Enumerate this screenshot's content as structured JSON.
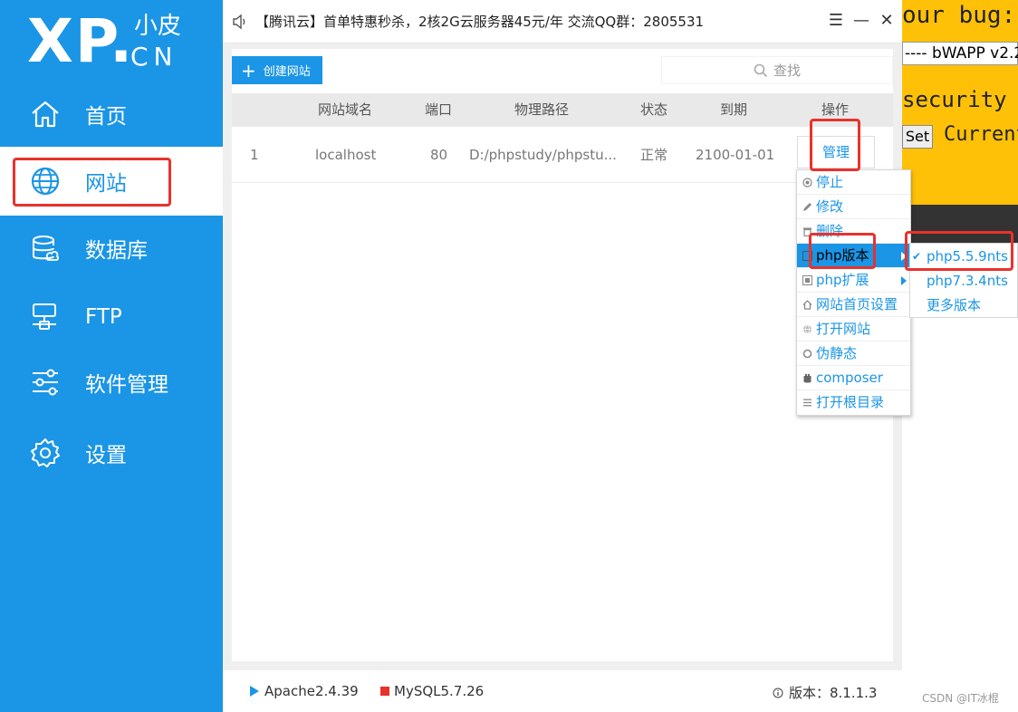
{
  "logo": {
    "main": "XP.",
    "small": "小皮",
    "domain": "CN"
  },
  "sidebar": {
    "items": [
      {
        "label": "首页",
        "icon": "home-icon"
      },
      {
        "label": "网站",
        "icon": "globe-icon",
        "active": true
      },
      {
        "label": "数据库",
        "icon": "database-icon"
      },
      {
        "label": "FTP",
        "icon": "ftp-server-icon"
      },
      {
        "label": "软件管理",
        "icon": "sliders-icon"
      },
      {
        "label": "设置",
        "icon": "gear-icon"
      }
    ]
  },
  "topbar": {
    "notice": "【腾讯云】首单特惠秒杀，2核2G云服务器45元/年 交流QQ群：2805531",
    "menu_glyph": "☰",
    "minimize_glyph": "—",
    "close_glyph": "✕"
  },
  "toolbar": {
    "create_label": "创建网站",
    "search_placeholder": "查找"
  },
  "table": {
    "headers": [
      "网站域名",
      "端口",
      "物理路径",
      "状态",
      "到期",
      "操作"
    ],
    "rows": [
      {
        "index": "1",
        "domain": "localhost",
        "port": "80",
        "path": "D:/phpstudy/phpstu...",
        "status": "正常",
        "expiry": "2100-01-01",
        "action": "管理"
      }
    ]
  },
  "context_menu": {
    "items": [
      {
        "label": "停止",
        "icon": "stop-icon"
      },
      {
        "label": "修改",
        "icon": "edit-icon"
      },
      {
        "label": "删除",
        "icon": "trash-icon"
      },
      {
        "label": "php版本",
        "icon": "php-icon",
        "submenu": true,
        "highlighted": true
      },
      {
        "label": "php扩展",
        "icon": "extension-icon",
        "submenu": true
      },
      {
        "label": "网站首页设置",
        "icon": "home-icon"
      },
      {
        "label": "打开网站",
        "icon": "globe-icon"
      },
      {
        "label": "伪静态",
        "icon": "refresh-icon"
      },
      {
        "label": "composer",
        "icon": "composer-icon"
      },
      {
        "label": "打开根目录",
        "icon": "list-icon"
      }
    ]
  },
  "php_versions": {
    "items": [
      {
        "label": "php5.5.9nts",
        "checked": true
      },
      {
        "label": "php7.3.4nts",
        "checked": false
      },
      {
        "label": "更多版本",
        "checked": false
      }
    ],
    "check_glyph": "✔"
  },
  "statusbar": {
    "apache": "Apache2.4.39",
    "mysql": "MySQL5.7.26",
    "version_label": "版本：8.1.1.3"
  },
  "background_browser": {
    "title": "our bug:",
    "select_value": "---- bWAPP v2.2",
    "security": "security lev",
    "set_button": "Set",
    "current": "Current"
  },
  "watermark": "CSDN @IT冰棍",
  "colors": {
    "primary": "#1b95e6",
    "highlight_red": "#e8322c",
    "bg_yellow": "#ffc107"
  }
}
